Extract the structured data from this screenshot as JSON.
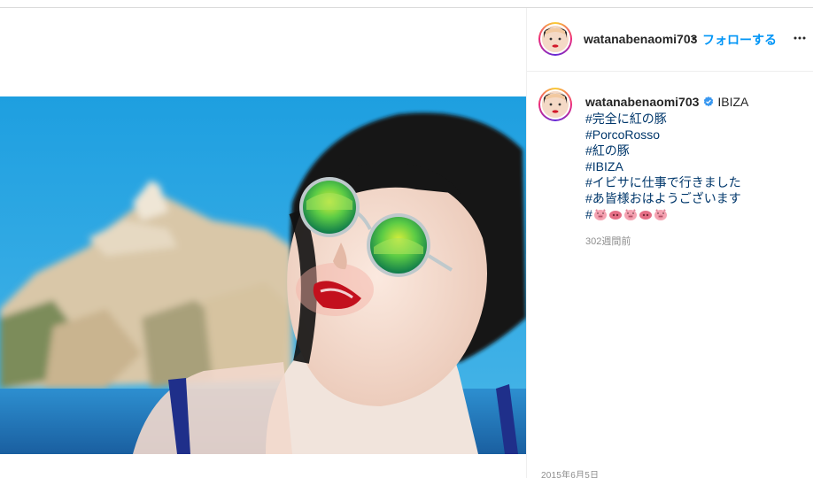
{
  "post": {
    "author": "watanabenaomi703",
    "separator": "•",
    "follow_label": "フォローする",
    "more_icon": "more-horizontal-icon",
    "photo_alt": "watanabenaomi703 post photo"
  },
  "caption": {
    "author": "watanabenaomi703",
    "verified_icon": "verified-badge-icon",
    "location": "IBIZA",
    "lines": [
      "#完全に紅の豚",
      "#PorcoRosso",
      "#紅の豚",
      "#IBIZA",
      "#イビサに仕事で行きました",
      "#あ皆様おはようございます"
    ],
    "emoji_line_prefix": "#",
    "emoji_icons": [
      "pig-face-icon",
      "pig-nose-icon",
      "pig-face-icon",
      "pig-nose-icon",
      "pig-face-icon"
    ],
    "ago": "302週間前"
  },
  "footer": {
    "date": "2015年6月5日"
  },
  "colors": {
    "link": "#00376b",
    "follow": "#0095f6",
    "muted": "#8e8e8e",
    "verified": "#3897f0"
  }
}
